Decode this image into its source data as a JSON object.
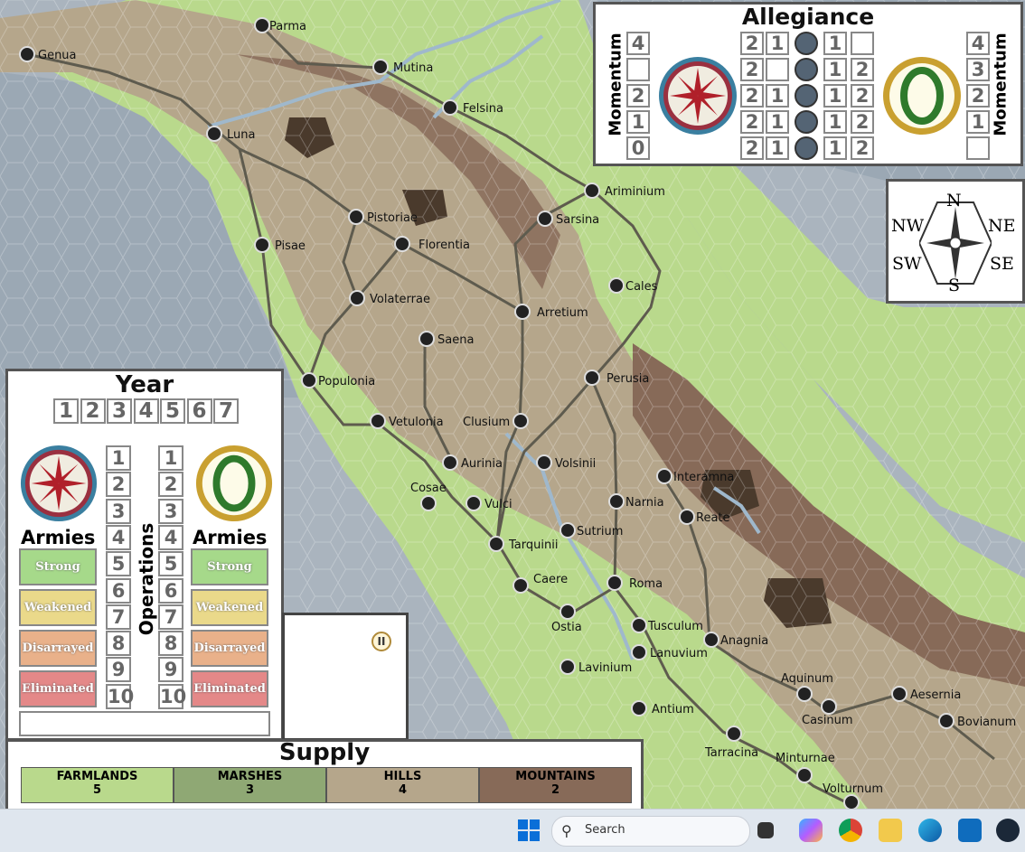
{
  "allegiance": {
    "title": "Allegiance",
    "left_label": "Momentum",
    "right_label": "Momentum",
    "left_track": [
      "4",
      "",
      "2",
      "1",
      "0"
    ],
    "right_track": [
      "4",
      "3",
      "2",
      "1",
      ""
    ],
    "rows": [
      {
        "a": "2",
        "b": "1",
        "c": "1",
        "d": ""
      },
      {
        "a": "2",
        "b": "",
        "c": "1",
        "d": "2"
      },
      {
        "a": "2",
        "b": "1",
        "c": "1",
        "d": "2"
      },
      {
        "a": "2",
        "b": "1",
        "c": "1",
        "d": "2"
      },
      {
        "a": "2",
        "b": "1",
        "c": "1",
        "d": "2"
      }
    ]
  },
  "compass": {
    "n": "N",
    "s": "S",
    "nw": "NW",
    "ne": "NE",
    "sw": "SW",
    "se": "SE"
  },
  "year_panel": {
    "title": "Year",
    "years": [
      "1",
      "2",
      "3",
      "4",
      "5",
      "6",
      "7"
    ],
    "operations_label": "Operations",
    "armies_label_left": "Armies",
    "armies_label_right": "Armies",
    "ops_numbers": [
      "1",
      "2",
      "3",
      "4",
      "5",
      "6",
      "7",
      "8",
      "9",
      "10"
    ],
    "left_states": [
      "Strong",
      "Weakened",
      "Disarrayed",
      "Eliminated"
    ],
    "right_states": [
      "Strong",
      "Weakened",
      "Disarrayed",
      "Eliminated"
    ]
  },
  "supply": {
    "title": "Supply",
    "cells": [
      {
        "label": "FARMLANDS",
        "value": "5",
        "color": "#b9d98c"
      },
      {
        "label": "MARSHES",
        "value": "3",
        "color": "#8fa874"
      },
      {
        "label": "HILLS",
        "value": "4",
        "color": "#b5a68b"
      },
      {
        "label": "MOUNTAINS",
        "value": "2",
        "color": "#876a58"
      }
    ]
  },
  "cities": [
    "Parma",
    "Genua",
    "Mutina",
    "Felsina",
    "Luna",
    "Ariminium",
    "Sarsina",
    "Pistoriae",
    "Florentia",
    "Pisae",
    "Cales",
    "Volaterrae",
    "Arretium",
    "Saena",
    "Populonia",
    "Perusia",
    "Vetulonia",
    "Clusium",
    "Aurinia",
    "Volsinii",
    "Interamna",
    "Cosae",
    "Vulci",
    "Narnia",
    "Reate",
    "Tarquinii",
    "Sutrium",
    "Caere",
    "Roma",
    "Ostia",
    "Tusculum",
    "Anagnia",
    "Lanuvium",
    "Lavinium",
    "Aquinum",
    "Aesernia",
    "Antium",
    "Casinum",
    "Bovianum",
    "Tarracina",
    "Minturnae",
    "Volturnum"
  ],
  "taskbar": {
    "search_placeholder": "Search"
  },
  "colors": {
    "farmland": "#b9d98c",
    "hills": "#b5a68b",
    "mountains": "#876a58",
    "sea": "#aab4be",
    "road": "#5e5b4e",
    "river": "#9fb8cc"
  }
}
